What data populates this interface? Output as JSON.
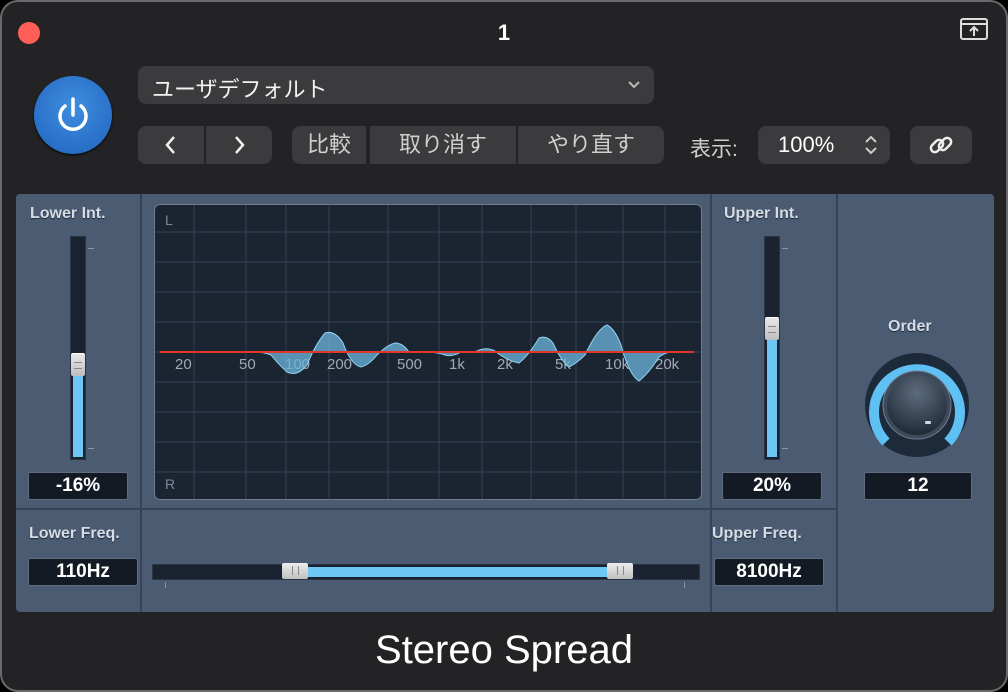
{
  "window": {
    "title": "1"
  },
  "header": {
    "preset": "ユーザデフォルト",
    "compare": "比較",
    "undo": "取り消す",
    "redo": "やり直す",
    "view_label": "表示:",
    "zoom": "100%"
  },
  "plugin": {
    "name": "Stereo Spread",
    "lower_int": {
      "label": "Lower Int.",
      "value": "-16%",
      "level": 0.42
    },
    "upper_int": {
      "label": "Upper Int.",
      "value": "20%",
      "level": 0.6
    },
    "lower_freq": {
      "label": "Lower Freq.",
      "value": "110Hz",
      "position": 0.26
    },
    "upper_freq": {
      "label": "Upper Freq.",
      "value": "8100Hz",
      "position": 0.855
    },
    "order": {
      "label": "Order",
      "value": "12"
    },
    "display": {
      "channel_top": "L",
      "channel_bottom": "R",
      "freq_labels": [
        "20",
        "50",
        "100",
        "200",
        "500",
        "1k",
        "2k",
        "5k",
        "10k",
        "20k"
      ]
    }
  },
  "colors": {
    "accent": "#6ec6f5",
    "power": "#2d78d0",
    "center_line": "#e0372b",
    "panel": "#4a5b72"
  },
  "icons": [
    "power-icon",
    "chevron-down-icon",
    "chevron-left-icon",
    "chevron-right-icon",
    "stepper-icon",
    "link-icon",
    "popout-icon"
  ]
}
